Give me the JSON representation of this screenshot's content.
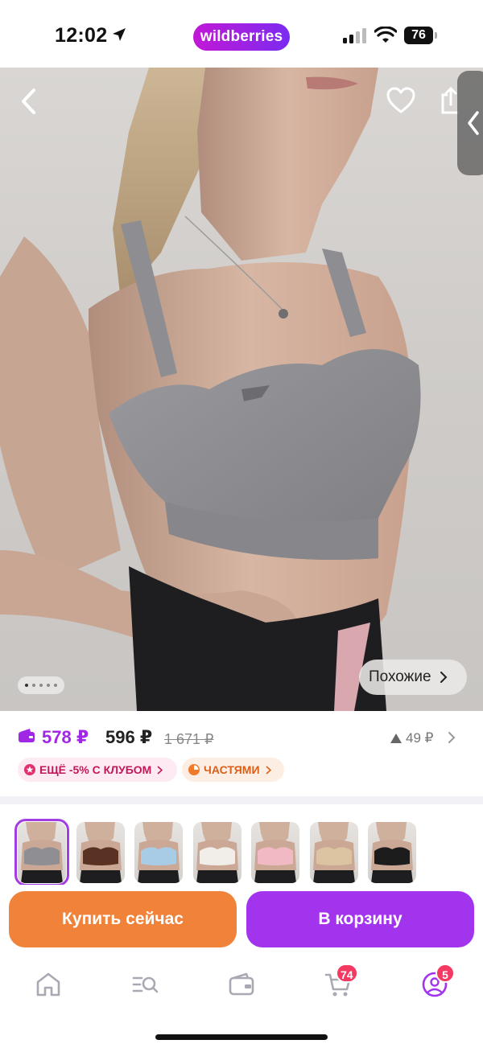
{
  "status_bar": {
    "time": "12:02",
    "app_pill": "wildberries",
    "battery": "76"
  },
  "product_gallery": {
    "slide_count": 5,
    "active_slide": 1,
    "similar_label": "Похожие"
  },
  "price": {
    "wallet_price": "578 ₽",
    "current_price": "596 ₽",
    "old_price": "1 671 ₽",
    "price_rise": "49 ₽"
  },
  "chips": {
    "club": "ЕЩЁ -5% С КЛУБОМ",
    "installments": "ЧАСТЯМИ"
  },
  "color_variants": [
    {
      "name": "серый",
      "color": "#8f8f93",
      "selected": true
    },
    {
      "name": "коричневый",
      "color": "#5a3224",
      "selected": false
    },
    {
      "name": "голубой",
      "color": "#a9cce6",
      "selected": false
    },
    {
      "name": "белый",
      "color": "#f1eeea",
      "selected": false
    },
    {
      "name": "розовый",
      "color": "#f0b9c4",
      "selected": false
    },
    {
      "name": "бежевый",
      "color": "#dcc4a2",
      "selected": false
    },
    {
      "name": "чёрный",
      "color": "#1c1c1c",
      "selected": false
    }
  ],
  "actions": {
    "buy_now": "Купить сейчас",
    "add_to_cart": "В корзину"
  },
  "tabbar": {
    "items": [
      "home-icon",
      "catalog-search-icon",
      "wallet-icon",
      "cart-icon",
      "profile-icon"
    ],
    "cart_badge": "74",
    "profile_badge": "5"
  },
  "colors": {
    "brand_purple": "#a334ee",
    "buy_orange": "#f0823a",
    "wallet_price_purple": "#a127e6",
    "badge_red": "#f43a63"
  }
}
